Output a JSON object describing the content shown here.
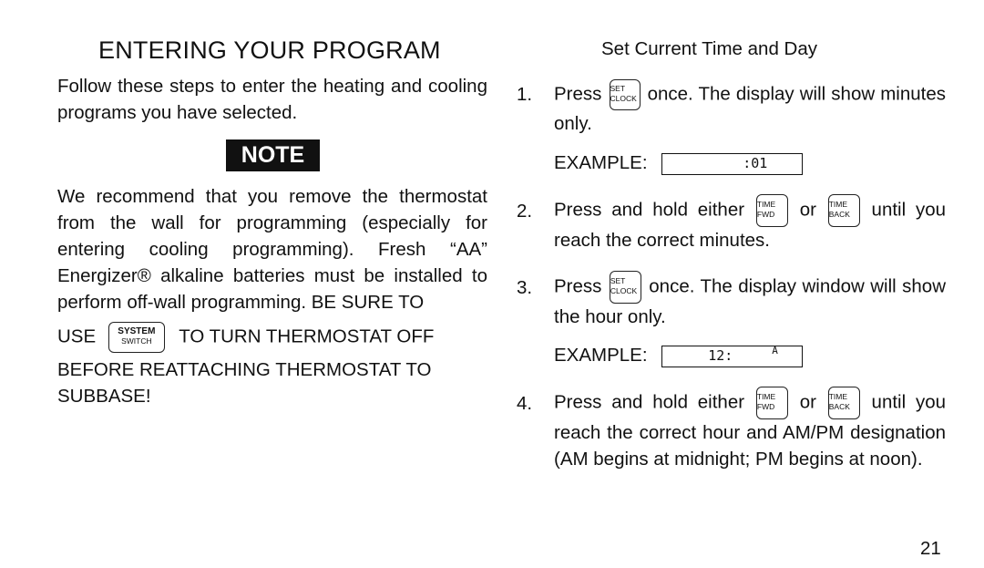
{
  "left": {
    "title": "ENTERING YOUR PROGRAM",
    "intro": "Follow these steps to enter the heating and cooling programs you have selected.",
    "note_label": "NOTE",
    "note_text": "We recommend that you remove the thermostat from the wall for programming (especially for entering cooling programming). Fresh “AA” Energizer® alkaline batteries must be installed to perform off-wall programming. BE SURE TO",
    "use_word": "USE",
    "system_key": {
      "line1": "SYSTEM",
      "line2": "SWITCH"
    },
    "turn_off": "TO TURN THERMOSTAT OFF",
    "before": "BEFORE REATTACHING THERMOSTAT TO SUBBASE!"
  },
  "right": {
    "heading": "Set Current Time and Day",
    "keys": {
      "set_clock": {
        "line1": "SET",
        "line2": "CLOCK"
      },
      "time_fwd": {
        "line1": "TIME",
        "line2": "FWD"
      },
      "time_back": {
        "line1": "TIME",
        "line2": "BACK"
      }
    },
    "steps": [
      {
        "num": "1.",
        "pre": "Press",
        "post": "once. The display will show minutes only.",
        "example_label": "EXAMPLE:",
        "display": ":01",
        "indicator": ""
      },
      {
        "num": "2.",
        "pre": "Press and hold either",
        "mid": "or",
        "post": "until you reach the correct minutes."
      },
      {
        "num": "3.",
        "pre": "Press",
        "post": "once. The display window will show the hour only.",
        "example_label": "EXAMPLE:",
        "display": "12:",
        "indicator": "A"
      },
      {
        "num": "4.",
        "pre": "Press and hold either",
        "mid": "or",
        "post": "until you reach the correct hour and AM/PM designation (AM begins at midnight; PM begins at noon)."
      }
    ]
  },
  "page_number": "21"
}
